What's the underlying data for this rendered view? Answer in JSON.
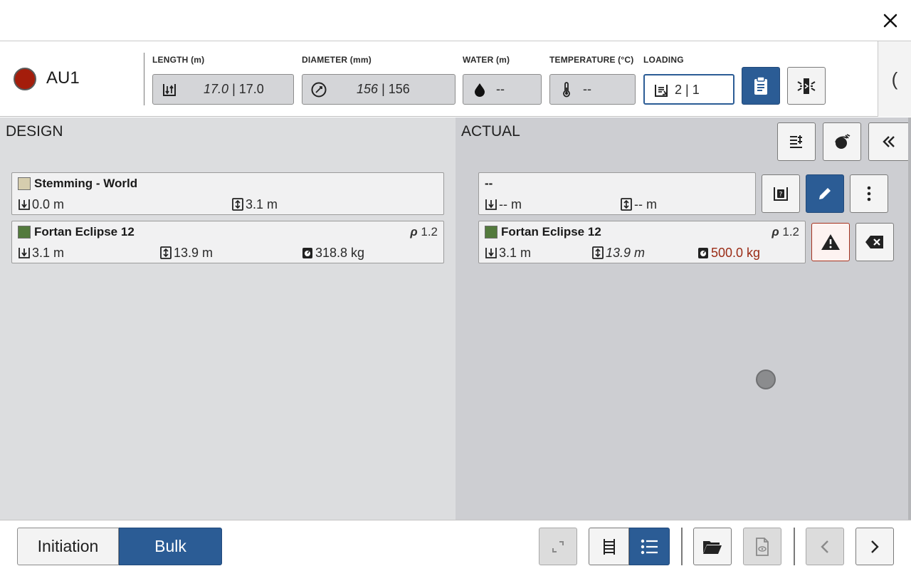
{
  "topbar": {
    "close_icon": "close-icon"
  },
  "header": {
    "hole_name": "AU1",
    "status_color": "#a41d0b",
    "fields": {
      "length": {
        "label": "LENGTH (m)",
        "design": "17.0",
        "actual": "| 17.0",
        "icon": "hole-length-icon"
      },
      "diameter": {
        "label": "DIAMETER (mm)",
        "design": "156",
        "actual": "| 156",
        "icon": "diameter-gauge-icon"
      },
      "water": {
        "label": "WATER (m)",
        "value": "--",
        "icon": "water-drop-icon"
      },
      "temperature": {
        "label": "TEMPERATURE (°C)",
        "value": "--",
        "icon": "thermometer-icon"
      },
      "loading": {
        "label": "LOADING",
        "value": "2 | 1",
        "icon": "loading-deck-icon"
      }
    },
    "side_tab_glyph": "("
  },
  "design": {
    "title": "DESIGN",
    "decks": [
      {
        "name": "Stemming - World",
        "color": "#d6cdae",
        "depth": "0.0 m",
        "length": "3.1 m"
      },
      {
        "name": "Fortan Eclipse 12",
        "color": "#537a3d",
        "rho_symbol": "ρ",
        "rho": "1.2",
        "depth": "3.1 m",
        "length": "13.9 m",
        "mass": "318.8 kg"
      }
    ]
  },
  "actual": {
    "title": "ACTUAL",
    "decks": [
      {
        "name": "--",
        "depth": "-- m",
        "length": "-- m"
      },
      {
        "name": "Fortan Eclipse 12",
        "color": "#537a3d",
        "rho_symbol": "ρ",
        "rho": "1.2",
        "depth": "3.1 m",
        "length": "13.9 m",
        "mass": "500.0 kg"
      }
    ]
  },
  "colors": {
    "primary": "#2b5c95",
    "warning": "#a6321f",
    "mass_error": "#9a2b15"
  },
  "bottom": {
    "tabs": [
      {
        "label": "Initiation",
        "selected": false
      },
      {
        "label": "Bulk",
        "selected": true
      }
    ]
  }
}
